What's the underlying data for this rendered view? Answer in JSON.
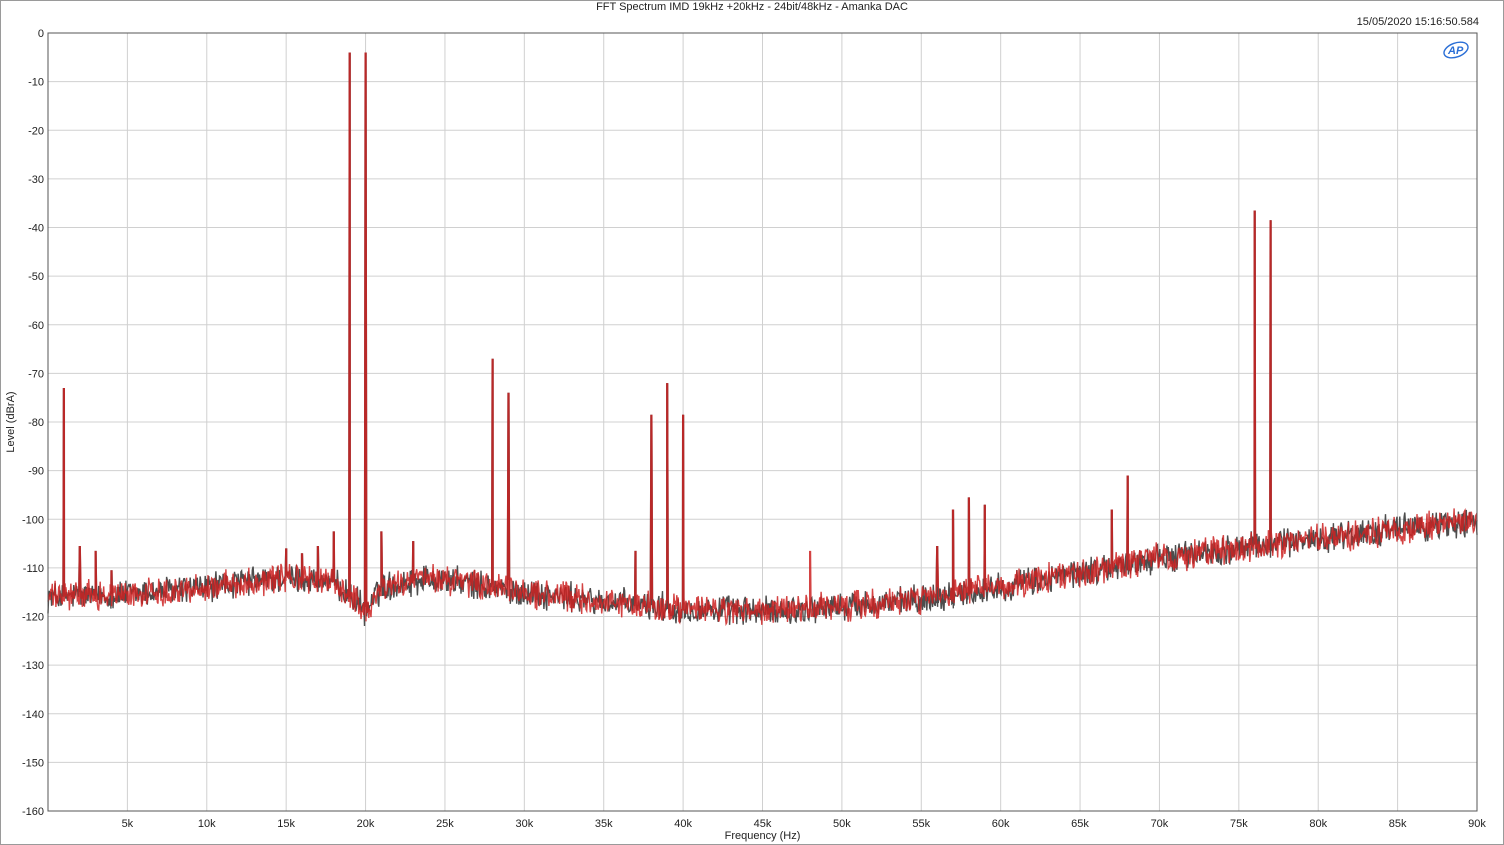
{
  "header": {
    "title": "FFT Spectrum IMD 19kHz +20kHz - 24bit/48kHz - Amanka DAC",
    "timestamp": "15/05/2020 15:16:50.584",
    "logo_text": "AP"
  },
  "colors": {
    "series_dark": "#3a3a3a",
    "series_red": "#cc2222",
    "grid": "#d0d0d0",
    "logo": "#2b6fd6"
  },
  "chart_data": {
    "type": "line",
    "title": "FFT Spectrum IMD 19kHz +20kHz - 24bit/48kHz - Amanka DAC",
    "xlabel": "Frequency (Hz)",
    "ylabel": "Level (dBrA)",
    "xlim": [
      0,
      90000
    ],
    "ylim": [
      -160,
      0
    ],
    "grid": true,
    "x_ticks": [
      5000,
      10000,
      15000,
      20000,
      25000,
      30000,
      35000,
      40000,
      45000,
      50000,
      55000,
      60000,
      65000,
      70000,
      75000,
      80000,
      85000,
      90000
    ],
    "x_tick_labels": [
      "5k",
      "10k",
      "15k",
      "20k",
      "25k",
      "30k",
      "35k",
      "40k",
      "45k",
      "50k",
      "55k",
      "60k",
      "65k",
      "70k",
      "75k",
      "80k",
      "85k",
      "90k"
    ],
    "y_ticks": [
      0,
      -10,
      -20,
      -30,
      -40,
      -50,
      -60,
      -70,
      -80,
      -90,
      -100,
      -110,
      -120,
      -130,
      -140,
      -150,
      -160
    ],
    "y_tick_labels": [
      "0",
      "-10",
      "-20",
      "-30",
      "-40",
      "-50",
      "-60",
      "-70",
      "-80",
      "-90",
      "-100",
      "-110",
      "-120",
      "-130",
      "-140",
      "-150",
      "-160"
    ],
    "noise_floor": {
      "x": [
        0,
        5000,
        10000,
        15000,
        18000,
        19500,
        20000,
        21000,
        24000,
        30000,
        35000,
        40000,
        45000,
        50000,
        55000,
        60000,
        65000,
        70000,
        75000,
        80000,
        85000,
        90000
      ],
      "y": [
        -116,
        -115.5,
        -114,
        -112,
        -113,
        -117,
        -119,
        -114,
        -112,
        -115,
        -117,
        -118.5,
        -119,
        -118,
        -116.5,
        -114,
        -111,
        -108,
        -106,
        -104,
        -102,
        -100.5
      ]
    },
    "series": [
      {
        "color_key": "series_dark",
        "peaks_x": [
          1000,
          2000,
          3000,
          4000,
          15000,
          16000,
          17000,
          18000,
          19000,
          20000,
          21000,
          23000,
          28000,
          29000,
          37000,
          38000,
          39000,
          40000,
          56000,
          57000,
          58000,
          59000,
          67000,
          68000,
          76000,
          77000
        ],
        "peaks_y": [
          -74.5,
          -107,
          -108,
          -112,
          -107.5,
          -108.5,
          -107,
          -104,
          -5.5,
          -5.5,
          -104,
          -106,
          -68.5,
          -75.5,
          -108,
          -80,
          -73.5,
          -80,
          -107,
          -99.5,
          -97,
          -98.5,
          -99.5,
          -92.5,
          -38,
          -40
        ]
      },
      {
        "color_key": "series_red",
        "peaks_x": [
          1000,
          2000,
          3000,
          4000,
          15000,
          16000,
          17000,
          18000,
          19000,
          20000,
          21000,
          23000,
          28000,
          29000,
          37000,
          38000,
          39000,
          40000,
          48000,
          56000,
          57000,
          58000,
          59000,
          67000,
          68000,
          76000,
          77000
        ],
        "peaks_y": [
          -74.5,
          -107,
          -108,
          -112,
          -107.5,
          -108.5,
          -107,
          -104,
          -5.5,
          -5.5,
          -104,
          -106,
          -68.5,
          -75.5,
          -108,
          -80,
          -73.5,
          -80,
          -108,
          -107,
          -99.5,
          -97,
          -98.5,
          -99.5,
          -92.5,
          -38,
          -40
        ]
      }
    ]
  }
}
